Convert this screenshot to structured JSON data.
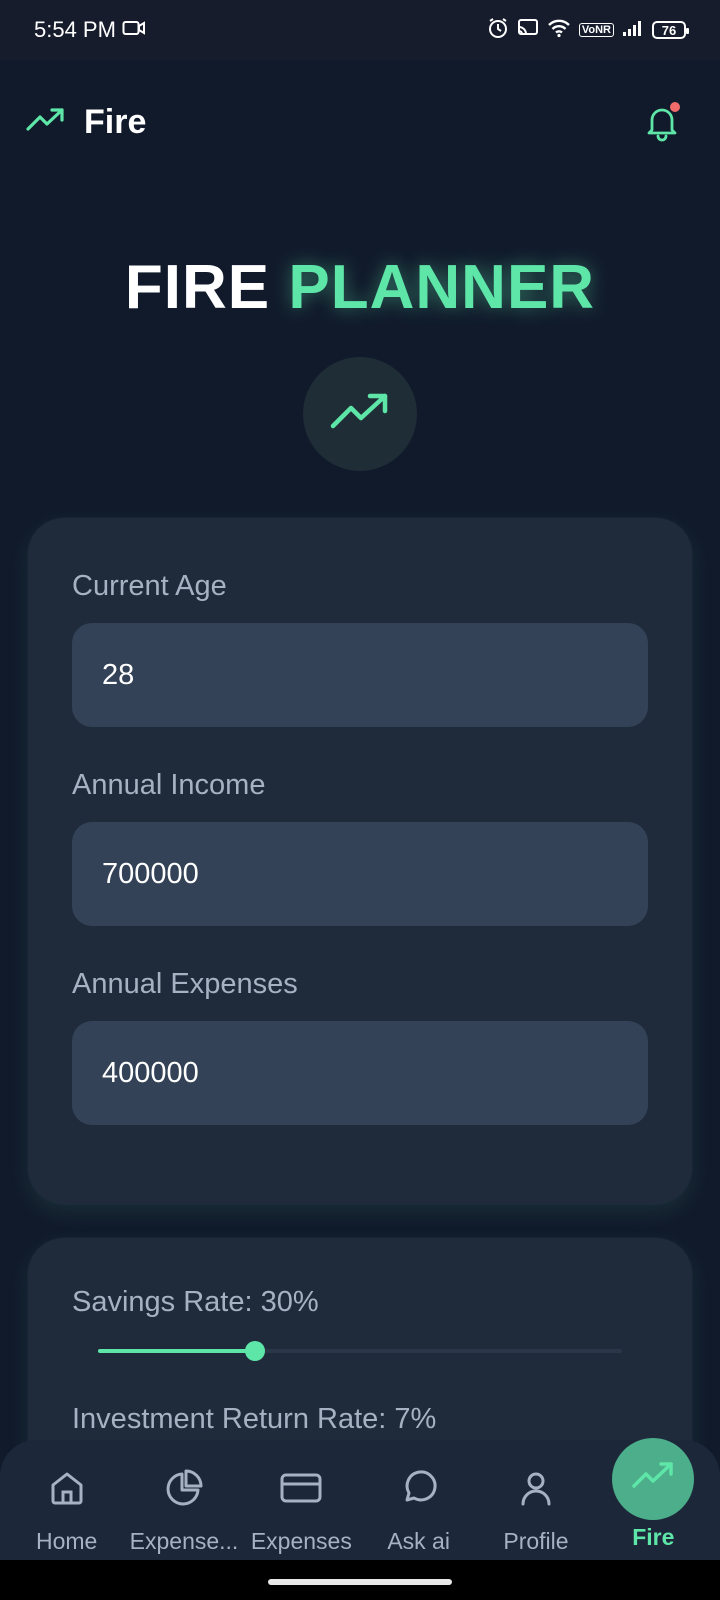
{
  "status_bar": {
    "time": "5:54 PM",
    "vonr": "VoNR",
    "battery": "76"
  },
  "header": {
    "title": "Fire"
  },
  "hero": {
    "title_part1": "FIRE",
    "title_part2": "PLANNER"
  },
  "form": {
    "fields": [
      {
        "label": "Current Age",
        "value": "28"
      },
      {
        "label": "Annual Income",
        "value": "700000"
      },
      {
        "label": "Annual Expenses",
        "value": "400000"
      }
    ]
  },
  "sliders": {
    "savings_label": "Savings Rate: 30%",
    "savings_value": 0.3,
    "investment_label": "Investment Return Rate: 7%"
  },
  "nav": {
    "items": [
      {
        "label": "Home",
        "icon": "home-icon"
      },
      {
        "label": "Expense...",
        "icon": "pie-chart-icon"
      },
      {
        "label": "Expenses",
        "icon": "credit-card-icon"
      },
      {
        "label": "Ask ai",
        "icon": "chat-bubble-icon"
      },
      {
        "label": "Profile",
        "icon": "user-icon"
      },
      {
        "label": "Fire",
        "icon": "trending-up-icon",
        "active": true
      }
    ]
  },
  "colors": {
    "accent": "#5ee6a8",
    "background": "#111a2b",
    "card": "#1f2a3b",
    "input": "#334257",
    "notification_dot": "#f26b6b"
  }
}
